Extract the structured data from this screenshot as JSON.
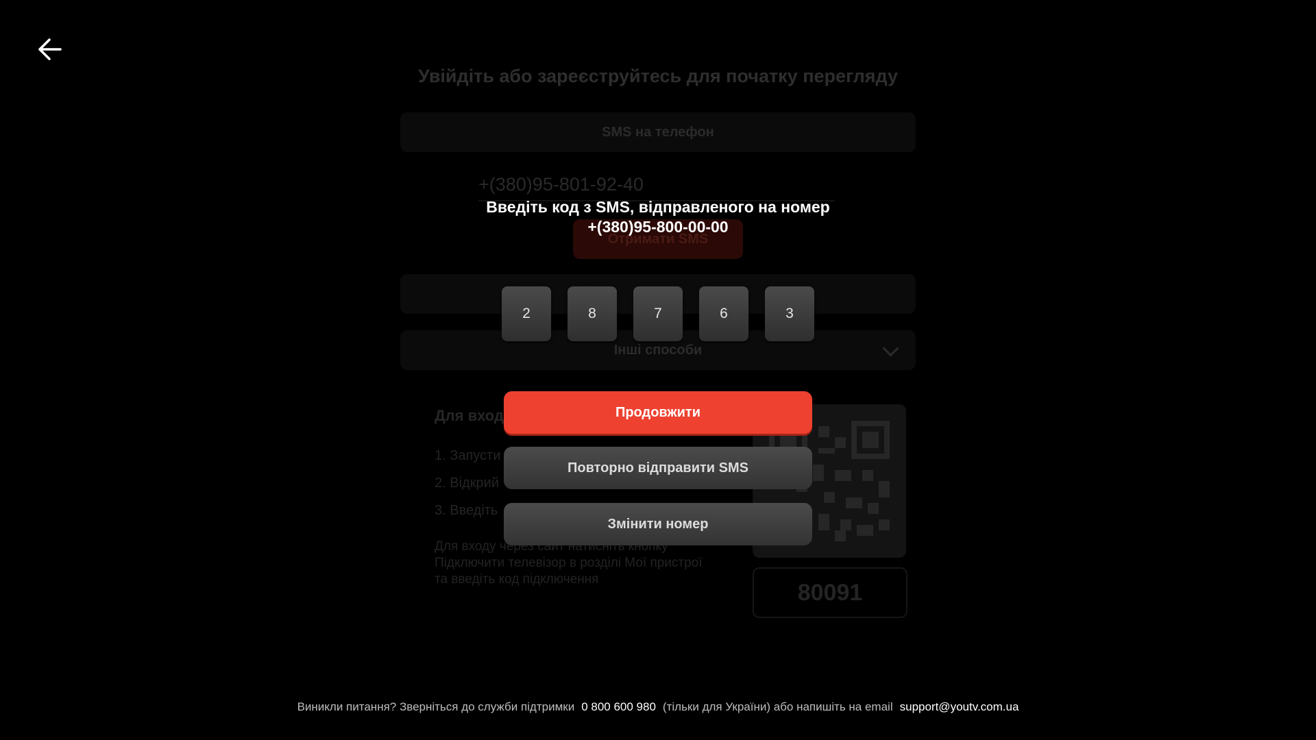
{
  "background": {
    "title": "Увійдіть або зареєструйтесь для початку перегляду",
    "tab_label": "SMS на телефон",
    "phone_value": "+(380)95-801-92-40",
    "get_sms_label": "Отримати SMS",
    "other_methods_label": "Інші способи",
    "tv_title": "Для вход",
    "steps": [
      "1. Запусти",
      "2. Відкрий",
      "3. Введіть"
    ],
    "note": "Для входу через сайт натисніть кнопку Підключити телевізор в розділі Мої пристрої та введіть код підключення",
    "tv_code": "80091"
  },
  "modal": {
    "title_line1": "Введіть код з SMS, відправленого на номер",
    "title_line2": "+(380)95-800-00-00",
    "code_digits": [
      "2",
      "8",
      "7",
      "6",
      "3"
    ],
    "continue_label": "Продовжити",
    "resend_label": "Повторно відправити SMS",
    "change_number_label": "Змінити номер"
  },
  "footer": {
    "question": "Виникли питання? Зверніться до служби підтримки",
    "phone": "0 800 600 980",
    "middle": "(тільки для України) або напишіть на email",
    "email": "support@youtv.com.ua"
  },
  "icons": {
    "back": "arrow-left-icon",
    "dropdown": "chevron-down-icon"
  },
  "colors": {
    "accent": "#ee4130",
    "background": "#000000"
  }
}
